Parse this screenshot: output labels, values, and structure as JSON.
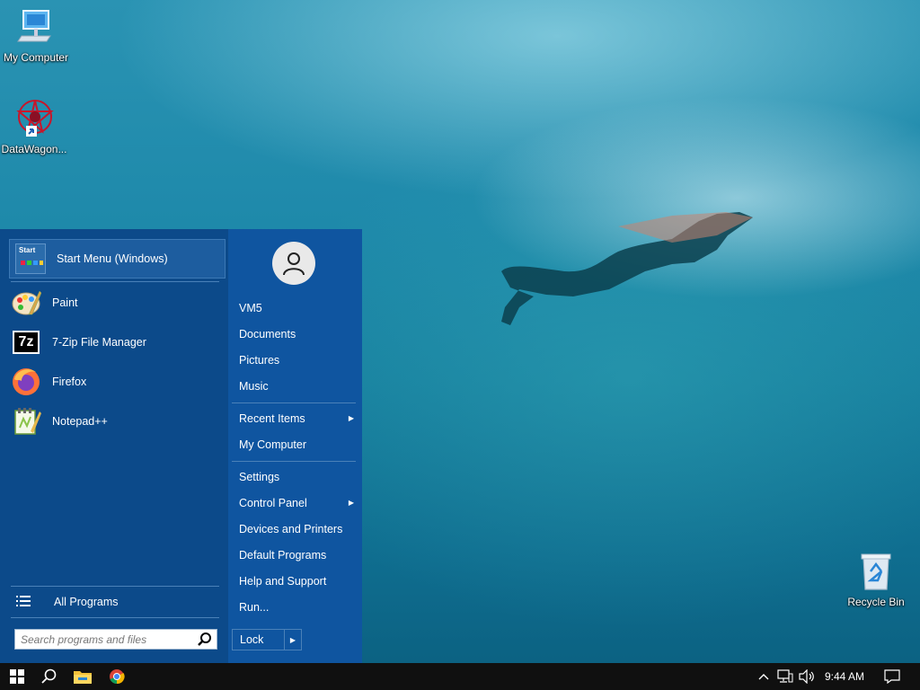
{
  "desktop": {
    "icons": [
      {
        "label": "My Computer",
        "icon": "computer-icon"
      },
      {
        "label": "DataWagon...",
        "icon": "datawagon-icon"
      },
      {
        "label": "Recycle Bin",
        "icon": "recycle-bin-icon"
      }
    ]
  },
  "start_menu": {
    "pinned": {
      "label": "Start Menu (Windows)",
      "icon_text": "Start"
    },
    "programs": [
      {
        "label": "Paint",
        "icon": "paint-icon"
      },
      {
        "label": "7-Zip File Manager",
        "icon": "7zip-icon",
        "icon_text": "7z"
      },
      {
        "label": "Firefox",
        "icon": "firefox-icon"
      },
      {
        "label": "Notepad++",
        "icon": "notepadpp-icon"
      }
    ],
    "all_programs": "All Programs",
    "search_placeholder": "Search programs and files",
    "right": {
      "user": "VM5",
      "items": [
        "Documents",
        "Pictures",
        "Music"
      ],
      "recent_items": "Recent Items",
      "my_computer": "My Computer",
      "settings": "Settings",
      "control_panel": "Control Panel",
      "devices_printers": "Devices and Printers",
      "default_programs": "Default Programs",
      "help_support": "Help and Support",
      "run": "Run...",
      "lock": "Lock"
    }
  },
  "taskbar": {
    "clock": "9:44 AM"
  },
  "colors": {
    "menu_left": "#0c4a8a",
    "menu_right": "#0f55a0",
    "taskbar": "#101010"
  }
}
